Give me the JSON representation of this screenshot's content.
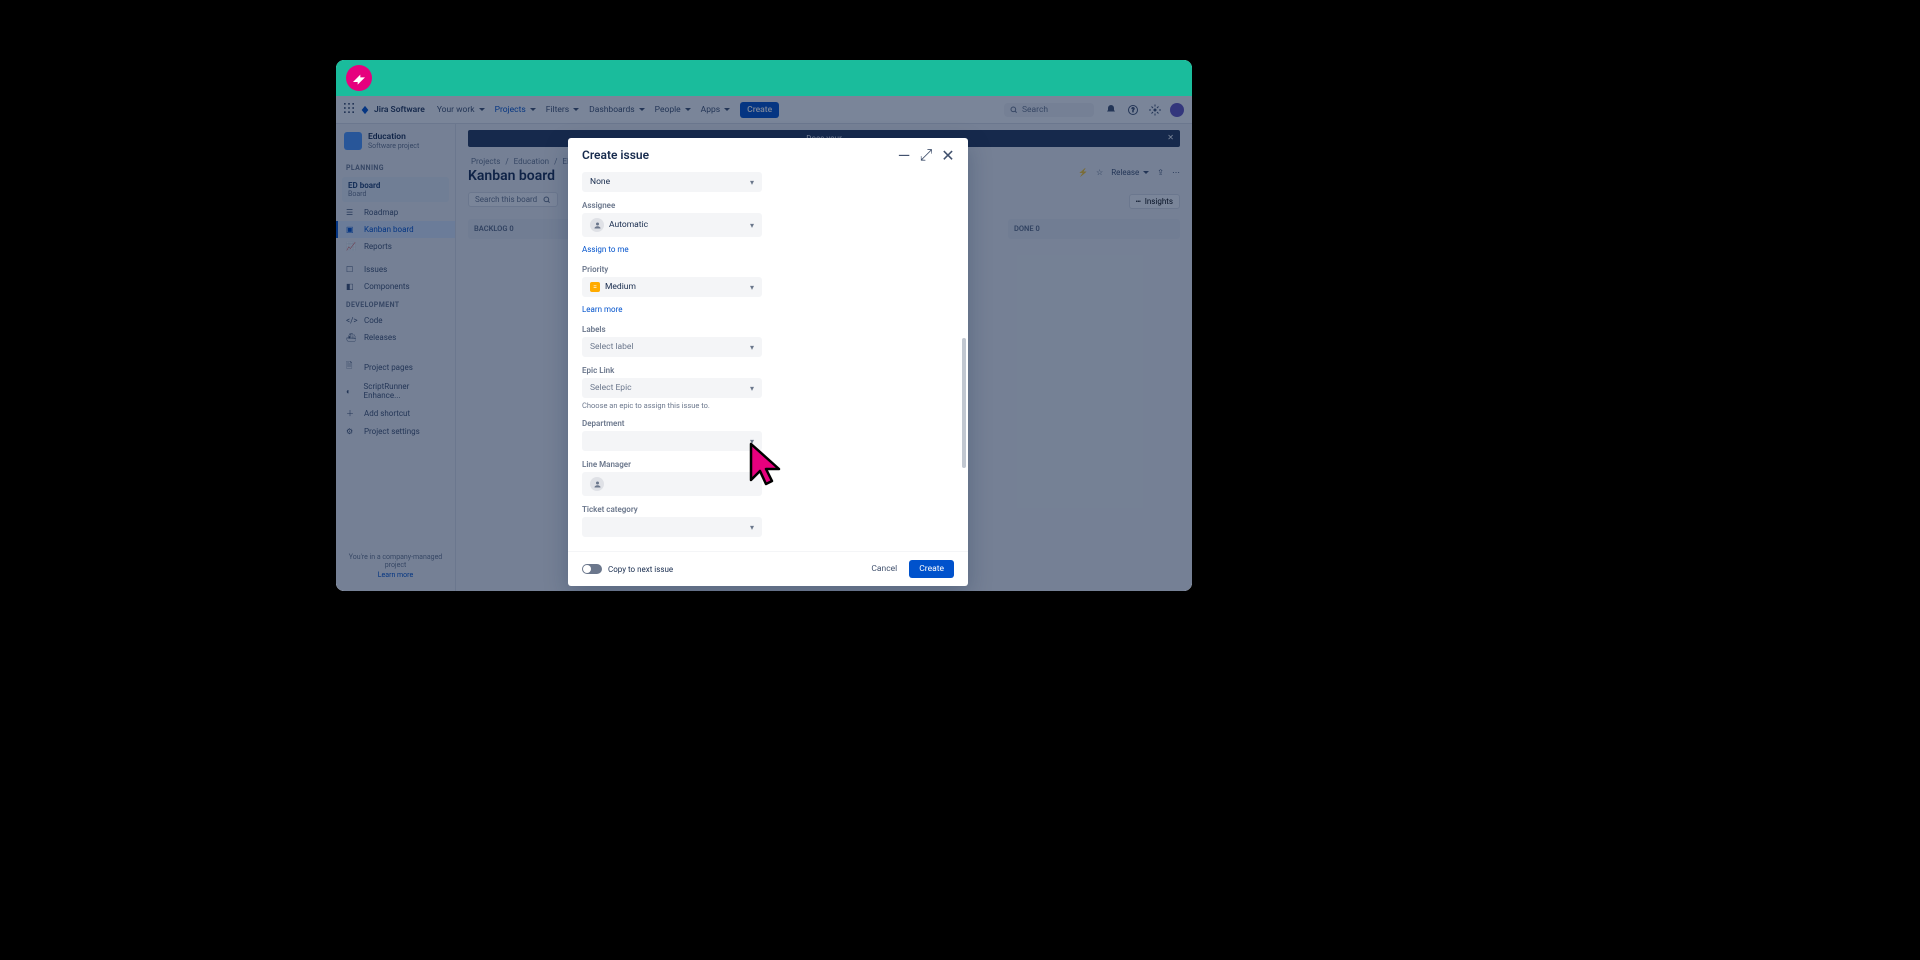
{
  "topnav": {
    "product": "Jira Software",
    "items": [
      {
        "label": "Your work",
        "active": false
      },
      {
        "label": "Projects",
        "active": true
      },
      {
        "label": "Filters",
        "active": false
      },
      {
        "label": "Dashboards",
        "active": false
      },
      {
        "label": "People",
        "active": false
      },
      {
        "label": "Apps",
        "active": false
      }
    ],
    "create": "Create",
    "search_placeholder": "Search"
  },
  "sidebar": {
    "project_name": "Education",
    "project_sub": "Software project",
    "sections": {
      "planning": "PLANNING",
      "development": "DEVELOPMENT"
    },
    "board_expand": {
      "title": "ED board",
      "sub": "Board"
    },
    "items_planning": [
      {
        "label": "Roadmap"
      },
      {
        "label": "Kanban board",
        "selected": true
      },
      {
        "label": "Reports"
      },
      {
        "label": "Issues"
      },
      {
        "label": "Components"
      }
    ],
    "items_dev": [
      {
        "label": "Code"
      },
      {
        "label": "Releases"
      }
    ],
    "items_bottom": [
      {
        "label": "Project pages"
      },
      {
        "label": "ScriptRunner Enhance..."
      },
      {
        "label": "Add shortcut"
      },
      {
        "label": "Project settings"
      }
    ],
    "footer1": "You're in a company-managed project",
    "footer2": "Learn more"
  },
  "main": {
    "banner": "Does your",
    "crumbs": [
      "Projects",
      "Education",
      "ED"
    ],
    "title": "Kanban board",
    "search_placeholder": "Search this board",
    "actions": {
      "release": "Release"
    },
    "insights": "Insights",
    "columns": [
      {
        "name": "BACKLOG",
        "count": 0
      },
      {
        "name": "DONE",
        "count": 0
      }
    ]
  },
  "modal": {
    "title": "Create issue",
    "fields": {
      "component_value": "None",
      "assignee_label": "Assignee",
      "assignee_value": "Automatic",
      "assign_link": "Assign to me",
      "priority_label": "Priority",
      "priority_value": "Medium",
      "priority_help": "Learn more",
      "labels_label": "Labels",
      "labels_placeholder": "Select label",
      "epic_label": "Epic Link",
      "epic_placeholder": "Select Epic",
      "epic_help": "Choose an epic to assign this issue to.",
      "department_label": "Department",
      "line_manager_label": "Line Manager",
      "ticket_cat_label": "Ticket category"
    },
    "footer": {
      "copy_label": "Copy to next issue",
      "cancel": "Cancel",
      "create": "Create"
    }
  }
}
